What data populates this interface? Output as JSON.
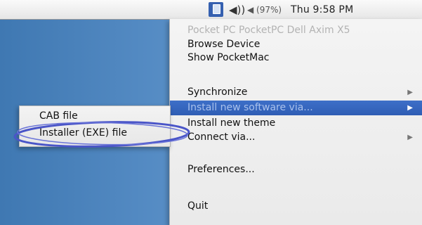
{
  "menubar": {
    "pocketmac_icon": "pocketmac-menu-extra-icon",
    "volume_icon": "speaker-volume-icon",
    "volume_glyph": "◀))",
    "battery_text": "◀ (97%)",
    "clock": "Thu 9:58 PM"
  },
  "menu": {
    "header": "Pocket PC PocketPC Dell Axim X5",
    "items": [
      {
        "label": "Browse Device"
      },
      {
        "label": "Show PocketMac"
      },
      {
        "label": "Synchronize",
        "submenu": true
      },
      {
        "label": "Install new software via...",
        "submenu": true,
        "highlighted": true
      },
      {
        "label": "Install new theme"
      },
      {
        "label": "Connect via...",
        "submenu": true
      },
      {
        "label": "Preferences..."
      },
      {
        "label": "Quit"
      }
    ],
    "submenu_arrow": "▶"
  },
  "submenu": {
    "items": [
      {
        "label": "CAB file"
      },
      {
        "label": "Installer (EXE) file"
      }
    ]
  },
  "colors": {
    "highlight": "#2f5db4",
    "annotation": "#4a55c8",
    "desktop": "#4a84bf"
  }
}
